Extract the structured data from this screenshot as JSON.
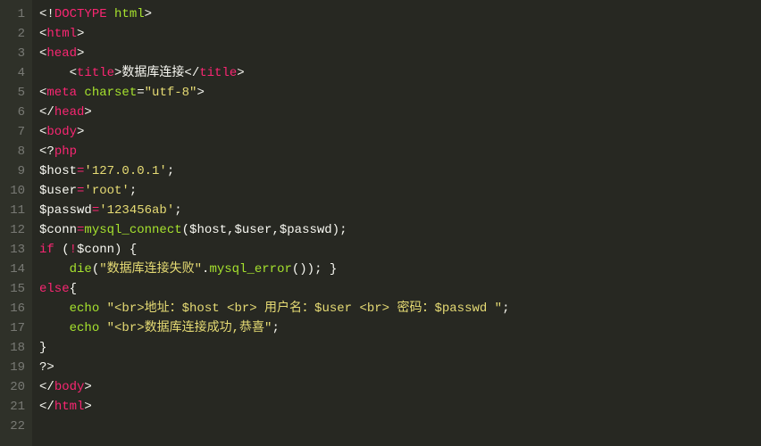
{
  "lines": [
    [
      {
        "cls": "p",
        "t": "<"
      },
      {
        "cls": "p",
        "t": "!"
      },
      {
        "cls": "t",
        "t": "DOCTYPE"
      },
      {
        "cls": "p",
        "t": " "
      },
      {
        "cls": "a",
        "t": "html"
      },
      {
        "cls": "p",
        "t": ">"
      }
    ],
    [
      {
        "cls": "p",
        "t": "<"
      },
      {
        "cls": "t",
        "t": "html"
      },
      {
        "cls": "p",
        "t": ">"
      }
    ],
    [
      {
        "cls": "p",
        "t": "<"
      },
      {
        "cls": "t",
        "t": "head"
      },
      {
        "cls": "p",
        "t": ">"
      }
    ],
    [
      {
        "cls": "p",
        "t": "    <"
      },
      {
        "cls": "t",
        "t": "title"
      },
      {
        "cls": "p",
        "t": ">数据库连接</"
      },
      {
        "cls": "t",
        "t": "title"
      },
      {
        "cls": "p",
        "t": ">"
      }
    ],
    [
      {
        "cls": "p",
        "t": "<"
      },
      {
        "cls": "t",
        "t": "meta"
      },
      {
        "cls": "p",
        "t": " "
      },
      {
        "cls": "a",
        "t": "charset"
      },
      {
        "cls": "p",
        "t": "="
      },
      {
        "cls": "s",
        "t": "\"utf-8\""
      },
      {
        "cls": "p",
        "t": ">"
      }
    ],
    [
      {
        "cls": "p",
        "t": "</"
      },
      {
        "cls": "t",
        "t": "head"
      },
      {
        "cls": "p",
        "t": ">"
      }
    ],
    [
      {
        "cls": "p",
        "t": "<"
      },
      {
        "cls": "t",
        "t": "body"
      },
      {
        "cls": "p",
        "t": ">"
      }
    ],
    [
      {
        "cls": "p",
        "t": "<?"
      },
      {
        "cls": "t",
        "t": "php"
      }
    ],
    [
      {
        "cls": "p",
        "t": "$host"
      },
      {
        "cls": "t",
        "t": "="
      },
      {
        "cls": "s",
        "t": "'127.0.0.1'"
      },
      {
        "cls": "p",
        "t": ";"
      }
    ],
    [
      {
        "cls": "p",
        "t": "$user"
      },
      {
        "cls": "t",
        "t": "="
      },
      {
        "cls": "s",
        "t": "'root'"
      },
      {
        "cls": "p",
        "t": ";"
      }
    ],
    [
      {
        "cls": "p",
        "t": "$passwd"
      },
      {
        "cls": "t",
        "t": "="
      },
      {
        "cls": "s",
        "t": "'123456ab'"
      },
      {
        "cls": "p",
        "t": ";"
      }
    ],
    [
      {
        "cls": "p",
        "t": "$conn"
      },
      {
        "cls": "t",
        "t": "="
      },
      {
        "cls": "a",
        "t": "mysql_connect"
      },
      {
        "cls": "p",
        "t": "($host,$user,$passwd);"
      }
    ],
    [
      {
        "cls": "t",
        "t": "if"
      },
      {
        "cls": "p",
        "t": " ("
      },
      {
        "cls": "t",
        "t": "!"
      },
      {
        "cls": "p",
        "t": "$conn) {"
      }
    ],
    [
      {
        "cls": "p",
        "t": "    "
      },
      {
        "cls": "a",
        "t": "die"
      },
      {
        "cls": "p",
        "t": "("
      },
      {
        "cls": "s",
        "t": "\"数据库连接失败\""
      },
      {
        "cls": "p",
        "t": "."
      },
      {
        "cls": "a",
        "t": "mysql_error"
      },
      {
        "cls": "p",
        "t": "()); }"
      }
    ],
    [
      {
        "cls": "t",
        "t": "else"
      },
      {
        "cls": "p",
        "t": "{"
      }
    ],
    [
      {
        "cls": "p",
        "t": "    "
      },
      {
        "cls": "a",
        "t": "echo"
      },
      {
        "cls": "p",
        "t": " "
      },
      {
        "cls": "s",
        "t": "\"<br>地址：$host <br> 用户名：$user <br> 密码：$passwd \""
      },
      {
        "cls": "p",
        "t": ";"
      }
    ],
    [
      {
        "cls": "p",
        "t": "    "
      },
      {
        "cls": "a",
        "t": "echo"
      },
      {
        "cls": "p",
        "t": " "
      },
      {
        "cls": "s",
        "t": "\"<br>数据库连接成功,恭喜\""
      },
      {
        "cls": "p",
        "t": ";"
      }
    ],
    [
      {
        "cls": "p",
        "t": "}"
      }
    ],
    [
      {
        "cls": "p",
        "t": "?>"
      }
    ],
    [
      {
        "cls": "p",
        "t": "</"
      },
      {
        "cls": "t",
        "t": "body"
      },
      {
        "cls": "p",
        "t": ">"
      }
    ],
    [
      {
        "cls": "p",
        "t": "</"
      },
      {
        "cls": "t",
        "t": "html"
      },
      {
        "cls": "p",
        "t": ">"
      }
    ],
    []
  ]
}
